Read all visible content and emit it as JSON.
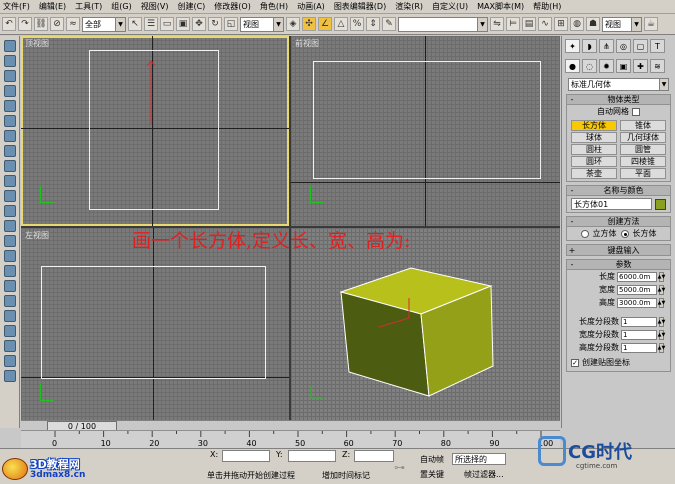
{
  "menu": [
    "文件(F)",
    "编辑(E)",
    "工具(T)",
    "组(G)",
    "视图(V)",
    "创建(C)",
    "修改器(O)",
    "角色(H)",
    "动画(A)",
    "图表编辑器(D)",
    "渲染(R)",
    "自定义(U)",
    "MAX脚本(M)",
    "帮助(H)"
  ],
  "toolbar": {
    "selection_filter": "全部",
    "ref_coord": "视图",
    "named_sel": "",
    "view_select": "视图"
  },
  "viewports": {
    "top": "顶视图",
    "front": "前视图",
    "left": "左视图",
    "persp": ""
  },
  "annotation": "画一个长方体,定义长、宽、高为:",
  "panel": {
    "category": "标准几何体",
    "object_type_title": "物体类型",
    "autogrid_label": "自动网格",
    "primitives": [
      "长方体",
      "锥体",
      "球体",
      "几何球体",
      "圆柱",
      "圆管",
      "圆环",
      "四棱锥",
      "茶壶",
      "平面"
    ],
    "selected_primitive": "长方体",
    "name_color_title": "名称与颜色",
    "object_name": "长方体01",
    "object_color": "#8aa020",
    "creation_method_title": "创建方法",
    "creation_cube": "立方体",
    "creation_box": "长方体",
    "keyboard_entry_title": "键盘输入",
    "params_title": "参数",
    "length_label": "长度",
    "length_value": "6000.0m",
    "width_label": "宽度",
    "width_value": "5000.0m",
    "height_label": "高度",
    "height_value": "3000.0m",
    "length_segs_label": "长度分段数",
    "length_segs_value": "1",
    "width_segs_label": "宽度分段数",
    "width_segs_value": "1",
    "height_segs_label": "高度分段数",
    "height_segs_value": "1",
    "gen_map_label": "创建贴图坐标"
  },
  "timeline": {
    "slider_label": "0 / 100",
    "ticks": [
      "0",
      "10",
      "20",
      "30",
      "40",
      "50",
      "60",
      "70",
      "80",
      "90",
      "100"
    ]
  },
  "status": {
    "x_label": "X:",
    "y_label": "Y:",
    "z_label": "Z:",
    "prompt": "单击并拖动开始创建过程",
    "add_time_tag": "增加时间标记",
    "auto_key": "自动帧",
    "set_key": "置关键",
    "selection_set": "所选择的",
    "key_filters": "帧过滤器..."
  },
  "branding": {
    "left_logo_main": "3D教程网",
    "left_logo_url": "3dmax8.cn",
    "right_logo": "CG时代",
    "right_logo_url": "cgtime.com"
  }
}
